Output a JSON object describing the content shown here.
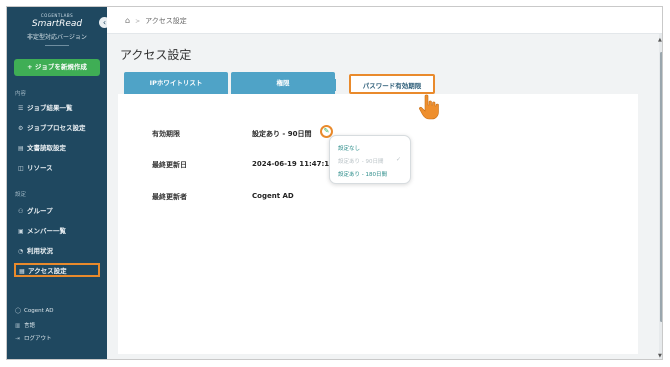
{
  "sidebar": {
    "brand_small": "COGENTLABS",
    "brand": "SmartRead",
    "brand_sub": "非定型対応バージョン",
    "collapse_icon": "chevron-left-icon",
    "new_job_label": "+ ジョブを新規作成",
    "section_main": "内容",
    "section_settings": "設定",
    "items_main": [
      {
        "label": "ジョブ結果一覧",
        "icon": "list-icon",
        "glyph": "☰"
      },
      {
        "label": "ジョブプロセス設定",
        "icon": "process-icon",
        "glyph": "⚙"
      },
      {
        "label": "文書読取設定",
        "icon": "document-icon",
        "glyph": "▤"
      },
      {
        "label": "リソース",
        "icon": "resource-icon",
        "glyph": "◫"
      }
    ],
    "items_settings": [
      {
        "label": "グループ",
        "icon": "group-icon",
        "glyph": "⚇"
      },
      {
        "label": "メンバー一覧",
        "icon": "members-icon",
        "glyph": "▣"
      },
      {
        "label": "利用状況",
        "icon": "usage-icon",
        "glyph": "◔"
      },
      {
        "label": "アクセス設定",
        "icon": "access-icon",
        "glyph": "▦",
        "active": true
      }
    ],
    "footer": [
      {
        "label": "Cogent AD",
        "icon": "user-icon",
        "glyph": "◯"
      },
      {
        "label": "言語",
        "icon": "language-icon",
        "glyph": "▥"
      },
      {
        "label": "ログアウト",
        "icon": "logout-icon",
        "glyph": "⇥"
      }
    ]
  },
  "breadcrumb": {
    "home_icon": "home-icon",
    "current": "アクセス設定"
  },
  "page": {
    "title": "アクセス設定"
  },
  "tabs": [
    {
      "label": "IPホワイトリスト"
    },
    {
      "label": "権限"
    },
    {
      "label": "パスワード有効期限",
      "active": true
    }
  ],
  "fields": {
    "expiry_label": "有効期限",
    "expiry_value": "設定あり - 90日間",
    "updated_at_label": "最終更新日",
    "updated_at_value": "2024-06-19 11:47:15",
    "updated_by_label": "最終更新者",
    "updated_by_value": "Cogent AD"
  },
  "dropdown": {
    "options": [
      {
        "label": "設定なし",
        "state": "enabled"
      },
      {
        "label": "設定あり - 90日間",
        "state": "selected"
      },
      {
        "label": "設定あり - 180日間",
        "state": "enabled"
      }
    ]
  },
  "colors": {
    "sidebar": "#1f4860",
    "accent_green": "#3fae55",
    "tab_blue": "#4fa3c7",
    "highlight_orange": "#e98a2c"
  }
}
